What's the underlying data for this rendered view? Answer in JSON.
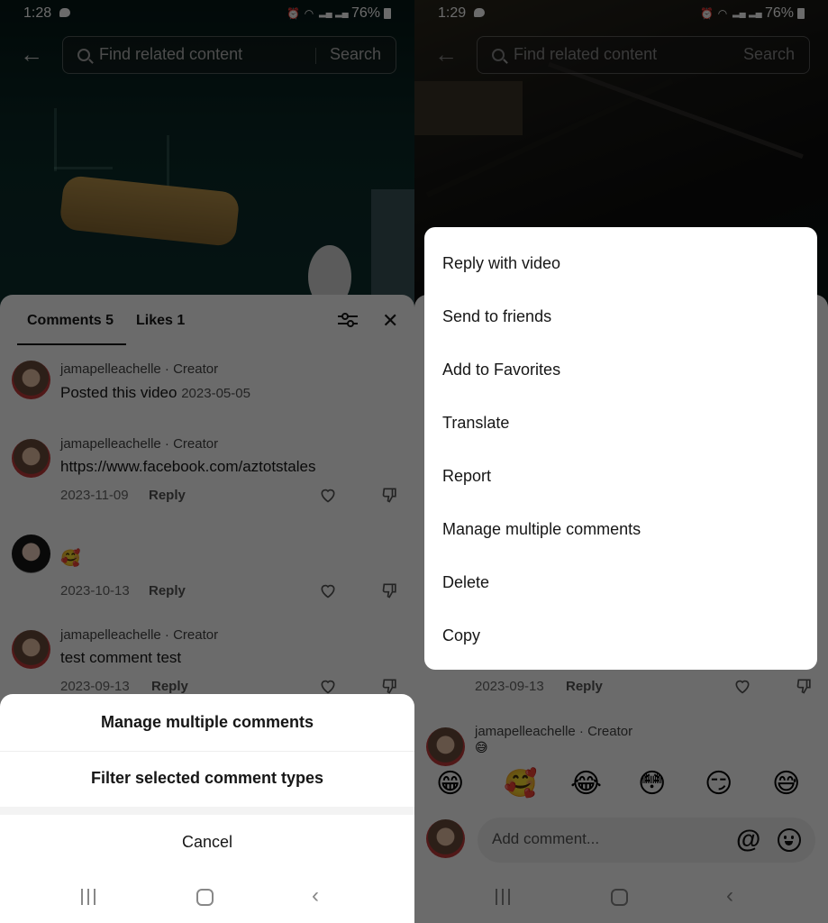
{
  "left_screen": {
    "status_bar": {
      "time": "1:28",
      "battery": "76%"
    },
    "search": {
      "placeholder": "Find related content",
      "button": "Search"
    },
    "tabs": {
      "comments": "Comments 5",
      "likes": "Likes 1"
    },
    "comments": [
      {
        "author": "jamapelleachelle · Creator",
        "text": "Posted this video",
        "date": "2023-05-05"
      },
      {
        "author": "jamapelleachelle · Creator",
        "text": "https://www.facebook.com/aztotstales",
        "date": "2023-11-09",
        "reply": "Reply"
      },
      {
        "author": "",
        "text": "🥰",
        "date": "2023-10-13",
        "reply": "Reply"
      },
      {
        "author": "jamapelleachelle · Creator",
        "text": "test comment test",
        "date": "2023-09-13",
        "reply": "Reply"
      }
    ],
    "action_sheet": {
      "items": [
        "Manage multiple comments",
        "Filter selected comment types"
      ],
      "cancel": "Cancel"
    }
  },
  "right_screen": {
    "status_bar": {
      "time": "1:29",
      "battery": "76%"
    },
    "search": {
      "placeholder": "Find related content",
      "button": "Search"
    },
    "context_menu": {
      "items": [
        "Reply with video",
        "Send to friends",
        "Add to Favorites",
        "Translate",
        "Report",
        "Manage multiple comments",
        "Delete",
        "Copy"
      ]
    },
    "background_comment": {
      "date": "2023-09-13",
      "reply": "Reply"
    },
    "last_comment": {
      "author": "jamapelleachelle · Creator",
      "text": "😅"
    },
    "emoji_bar": [
      "😁",
      "🥰",
      "😂",
      "😳",
      "😏",
      "😅"
    ],
    "comment_input": {
      "placeholder": "Add comment..."
    }
  }
}
